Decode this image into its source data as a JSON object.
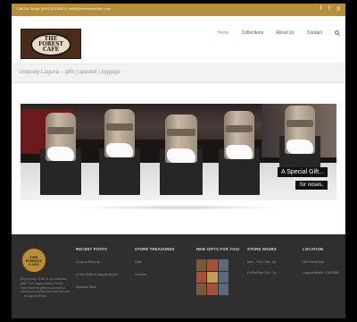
{
  "topbar": {
    "contact": "Call Us Today! (949) 494-9667 | hello@theforestcoffee.com",
    "social_icons": [
      "facebook-icon",
      "twitter-icon",
      "pinterest-icon"
    ]
  },
  "header": {
    "logo_text": "THE FOREST CAFE",
    "nav": [
      {
        "label": "Home",
        "active": true
      },
      {
        "label": "Collections",
        "active": false
      },
      {
        "label": "About Us",
        "active": false
      },
      {
        "label": "Contact",
        "active": false
      }
    ],
    "search_icon": "search-icon"
  },
  "tagline": "Uniquely Laguna – gifts | apparel | luggage",
  "hero": {
    "caption_line1": "A Special Gift...",
    "caption_line2": "for noses."
  },
  "footer": {
    "logo_text": "THE FOREST CAFE",
    "about": "Enjoy today. THAT is our business plan! The Laguna Beach Forest Store features gifts for yourself or others you will find that each will and ... in Laguna Beach.",
    "columns": [
      {
        "heading": "RECENT POSTS",
        "items": [
          "A Joy at Shop at...",
          "A Year Gets in Laguna Beach",
          "Specials Store"
        ]
      },
      {
        "heading": "STORE TREASURES",
        "items": [
          "Gifts",
          "Luxuries"
        ]
      },
      {
        "heading": "NEW GIFTS FOR YOU!",
        "items": []
      },
      {
        "heading": "STORE HOURS",
        "items": [
          "Mon - Thu | 10a - 6p",
          "Fri/Sat/Sun 10a - 7p"
        ]
      },
      {
        "heading": "LOCATION",
        "items": [
          "264 Forest Ave",
          "Laguna Beach, CA 92651"
        ]
      }
    ]
  },
  "colors": {
    "accent": "#b58f3c",
    "footer_bg": "#2f2f2f",
    "tagband_bg": "#f2f2f2"
  }
}
